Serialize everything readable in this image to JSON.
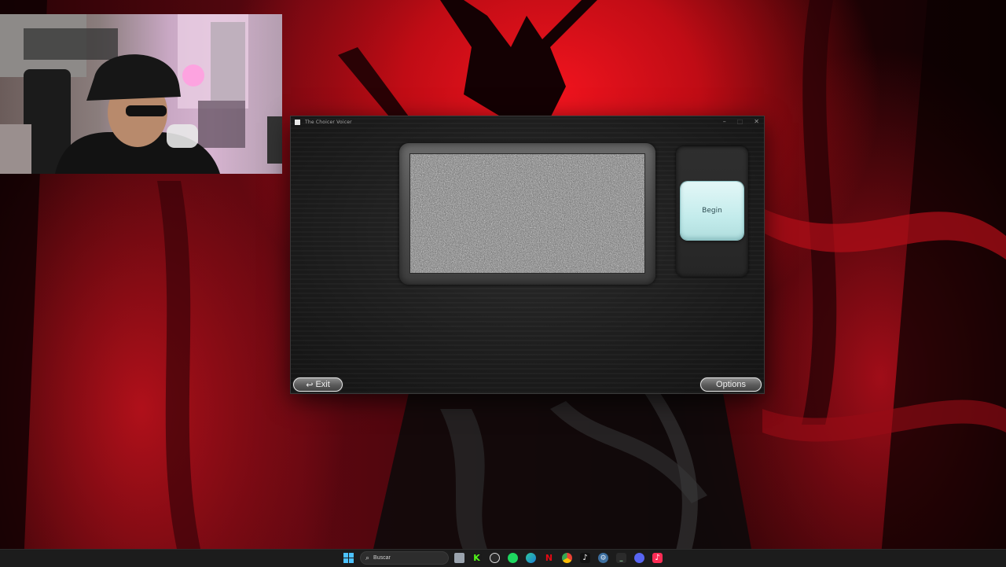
{
  "app_window": {
    "title": "The Choicer Voicer",
    "controls": {
      "minimize": "–",
      "maximize": "□",
      "close": "✕"
    },
    "begin_label": "Begin",
    "exit_label": "Exit",
    "options_label": "Options",
    "exit_icon": "↩"
  },
  "taskbar": {
    "search_placeholder": "Buscar",
    "search_glyph": "⌕",
    "icons": [
      "windows-start-icon",
      "search-icon",
      "file-explorer-icon",
      "kick-icon",
      "obs-icon",
      "spotify-icon",
      "edge-icon",
      "netflix-icon",
      "chrome-icon",
      "tiktok-icon",
      "settings-icon",
      "terminal-icon",
      "discord-icon",
      "tiktok-live-icon"
    ]
  },
  "colors": {
    "accent_begin": "#c4ecec",
    "wallpaper_red": "#e0121c",
    "taskbar_bg": "#1c1c1c"
  }
}
